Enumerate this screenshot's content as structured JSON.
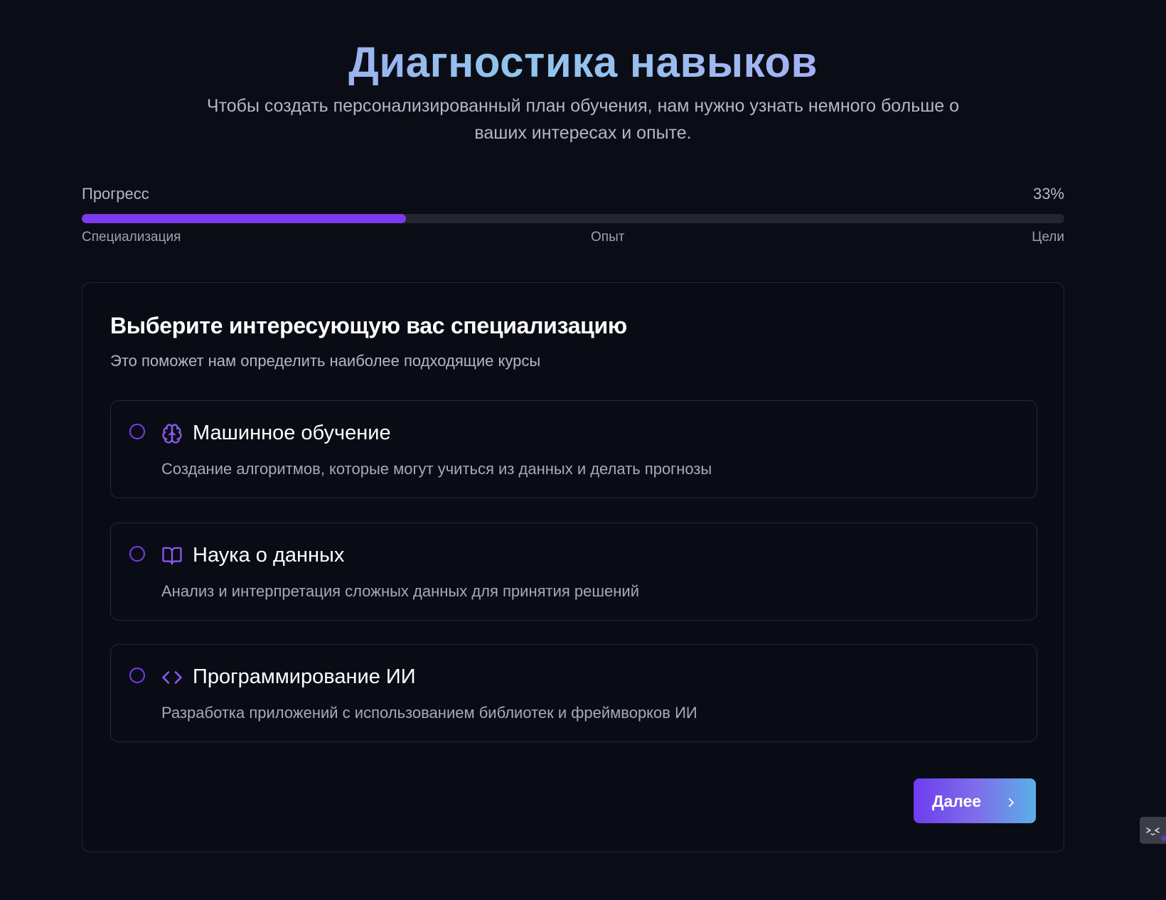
{
  "header": {
    "title": "Диагностика навыков",
    "subtitle": "Чтобы создать персонализированный план обучения, нам нужно узнать немного больше о ваших интересах и опыте."
  },
  "progress": {
    "label": "Прогресс",
    "value_text": "33%",
    "value": 0.33,
    "steps": [
      "Специализация",
      "Опыт",
      "Цели"
    ]
  },
  "question": {
    "title": "Выберите интересующую вас специализацию",
    "description": "Это поможет нам определить наиболее подходящие курсы",
    "options": [
      {
        "title": "Машинное обучение",
        "description": "Создание алгоритмов, которые могут учиться из данных и делать прогнозы",
        "icon": "brain-icon",
        "selected": false
      },
      {
        "title": "Наука о данных",
        "description": "Анализ и интерпретация сложных данных для принятия решений",
        "icon": "book-open-icon",
        "selected": false
      },
      {
        "title": "Программирование ИИ",
        "description": "Разработка приложений с использованием библиотек и фреймворков ИИ",
        "icon": "code-icon",
        "selected": false
      }
    ]
  },
  "actions": {
    "next_label": "Далее",
    "next_icon": "chevron-right-icon"
  },
  "colors": {
    "accent": "#7c3aed",
    "background": "#0b0d16",
    "button_gradient_start": "#6d3df0",
    "button_gradient_end": "#5ab0e6"
  }
}
